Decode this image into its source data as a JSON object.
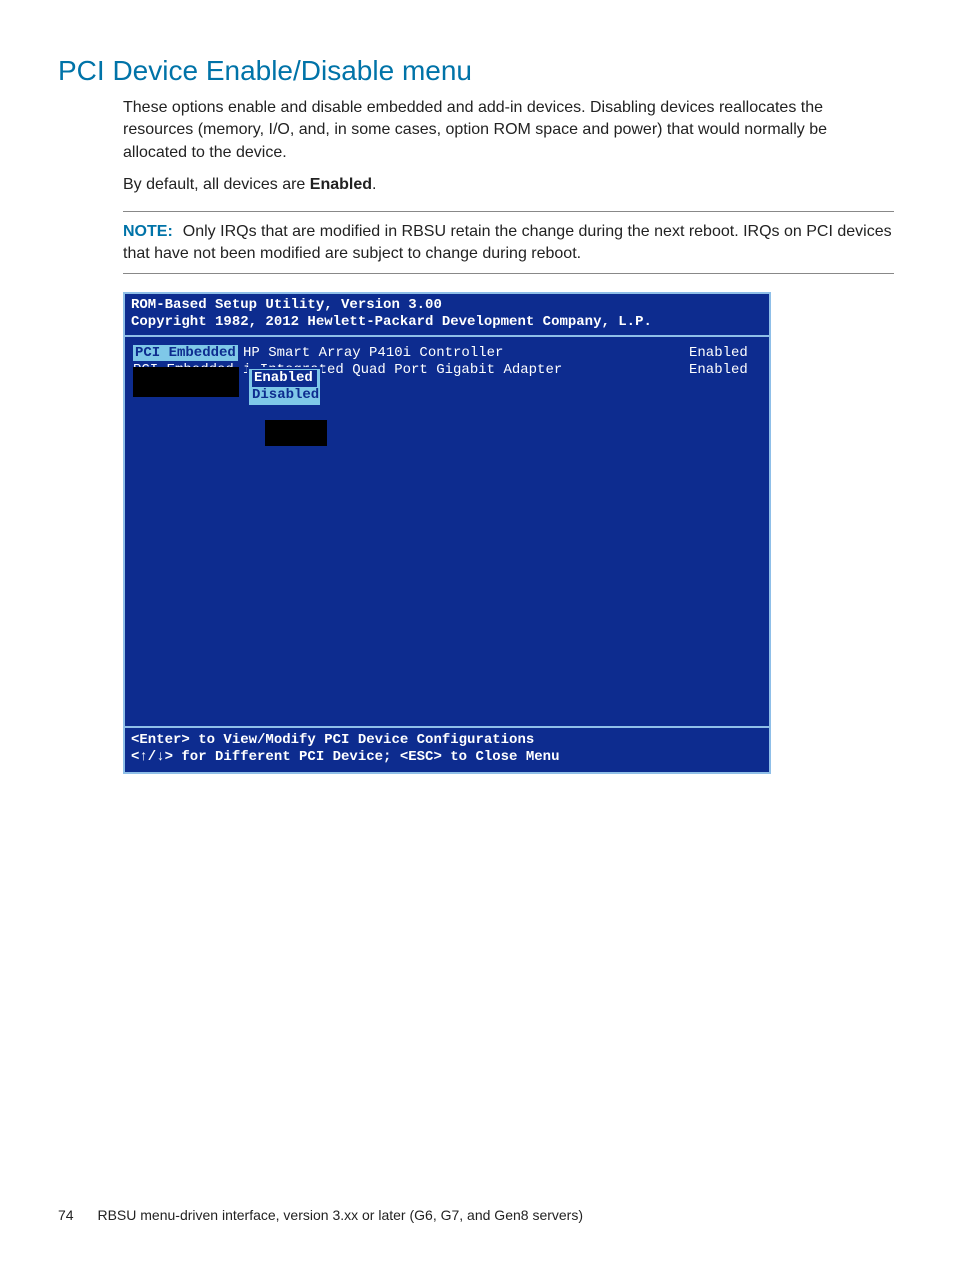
{
  "title": "PCI Device Enable/Disable menu",
  "paragraph1": "These options enable and disable embedded and add-in devices. Disabling devices reallocates the resources (memory, I/O, and, in some cases, option ROM space and power) that would normally be allocated to the device.",
  "paragraph2_prefix": "By default, all devices are ",
  "paragraph2_bold": "Enabled",
  "paragraph2_suffix": ".",
  "note_label": "NOTE:",
  "note_text": "Only IRQs that are modified in RBSU retain the change during the next reboot. IRQs on PCI devices that have not been modified are subject to change during reboot.",
  "bios": {
    "header1": "ROM-Based Setup Utility, Version 3.00",
    "header2": "Copyright 1982, 2012 Hewlett-Packard Development Company, L.P.",
    "rows": [
      {
        "label": "PCI Embedded",
        "desc": "HP Smart Array P410i Controller",
        "status": "Enabled",
        "selected": true
      },
      {
        "label": "PCI Embedded",
        "desc": "i Integrated Quad Port Gigabit Adapter",
        "status": "Enabled",
        "selected": false
      }
    ],
    "popup": {
      "options": [
        "Enabled",
        "Disabled"
      ],
      "selected_index": 0
    },
    "footer1": "<Enter> to View/Modify PCI Device Configurations",
    "footer2": "<↑/↓> for Different PCI Device; <ESC> to Close Menu"
  },
  "footer": {
    "page_number": "74",
    "text": "RBSU menu-driven interface, version 3.xx or later (G6, G7, and Gen8 servers)"
  }
}
